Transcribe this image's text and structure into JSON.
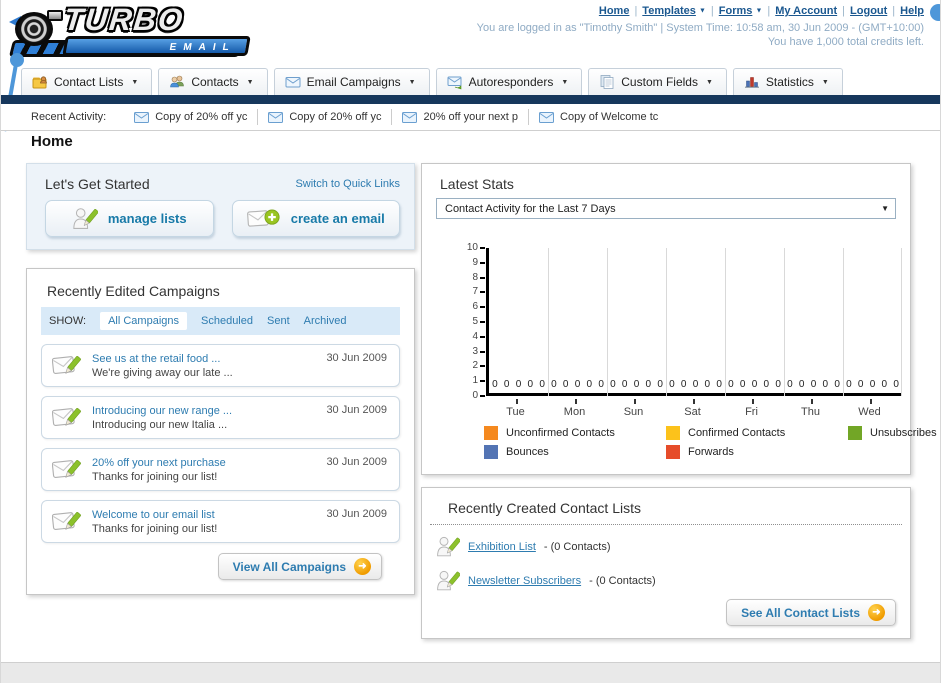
{
  "header": {
    "logo_title": "TURBO",
    "logo_subtitle": "EMAIL",
    "nav_links": [
      {
        "label": "Home",
        "dropdown": false
      },
      {
        "label": "Templates",
        "dropdown": true
      },
      {
        "label": "Forms",
        "dropdown": true
      },
      {
        "label": "My Account",
        "dropdown": false
      },
      {
        "label": "Logout",
        "dropdown": false
      },
      {
        "label": "Help",
        "dropdown": false
      }
    ],
    "login_info": "You are logged in as \"Timothy Smith\" | System Time: 10:58 am, 30 Jun 2009 - (GMT+10:00)",
    "credits_info": "You have 1,000 total credits left."
  },
  "nav_tabs": [
    {
      "label": "Contact Lists"
    },
    {
      "label": "Contacts"
    },
    {
      "label": "Email Campaigns"
    },
    {
      "label": "Autoresponders"
    },
    {
      "label": "Custom Fields"
    },
    {
      "label": "Statistics"
    }
  ],
  "recent_activity": {
    "label": "Recent Activity:",
    "items": [
      "Copy of 20% off yc",
      "Copy of 20% off yc",
      "20% off your next p",
      "Copy of Welcome tc"
    ]
  },
  "page_title": "Home",
  "get_started": {
    "title": "Let's Get Started",
    "switch_link": "Switch to Quick Links",
    "manage_lists_label": "manage lists",
    "create_email_label": "create an email"
  },
  "campaigns": {
    "title": "Recently Edited Campaigns",
    "show_label": "SHOW:",
    "filters": [
      "All Campaigns",
      "Scheduled",
      "Sent",
      "Archived"
    ],
    "active_filter": "All Campaigns",
    "items": [
      {
        "title": "See us at the retail food ...",
        "subtitle": "We're giving away our late ...",
        "date": "30 Jun 2009"
      },
      {
        "title": "Introducing our new range ...",
        "subtitle": "Introducing our new Italia ...",
        "date": "30 Jun 2009"
      },
      {
        "title": "20% off your next purchase",
        "subtitle": "Thanks for joining our list!",
        "date": "30 Jun 2009"
      },
      {
        "title": "Welcome to our email list",
        "subtitle": "Thanks for joining our list!",
        "date": "30 Jun 2009"
      }
    ],
    "view_all_label": "View All Campaigns"
  },
  "latest_stats": {
    "title": "Latest Stats",
    "dropdown_value": "Contact Activity for the Last 7 Days"
  },
  "chart_data": {
    "type": "bar",
    "title": "Contact Activity for the Last 7 Days",
    "categories": [
      "Tue",
      "Mon",
      "Sun",
      "Sat",
      "Fri",
      "Thu",
      "Wed"
    ],
    "series": [
      {
        "name": "Unconfirmed Contacts",
        "color": "#f5891f",
        "values": [
          0,
          0,
          0,
          0,
          0,
          0,
          0
        ]
      },
      {
        "name": "Confirmed Contacts",
        "color": "#fcc21b",
        "values": [
          0,
          0,
          0,
          0,
          0,
          0,
          0
        ]
      },
      {
        "name": "Unsubscribes",
        "color": "#72a626",
        "values": [
          0,
          0,
          0,
          0,
          0,
          0,
          0
        ]
      },
      {
        "name": "Bounces",
        "color": "#5374b4",
        "values": [
          0,
          0,
          0,
          0,
          0,
          0,
          0
        ]
      },
      {
        "name": "Forwards",
        "color": "#e64c2a",
        "values": [
          0,
          0,
          0,
          0,
          0,
          0,
          0
        ]
      }
    ],
    "xlabel": "",
    "ylabel": "",
    "ylim": [
      0,
      10
    ],
    "yticks": [
      0,
      1,
      2,
      3,
      4,
      5,
      6,
      7,
      8,
      9,
      10
    ],
    "grid": true,
    "legend_position": "bottom"
  },
  "contact_lists": {
    "title": "Recently Created Contact Lists",
    "items": [
      {
        "name": "Exhibition List",
        "detail": "- (0 Contacts)"
      },
      {
        "name": "Newsletter Subscribers",
        "detail": "- (0 Contacts)"
      }
    ],
    "see_all_label": "See All Contact Lists"
  },
  "colors": {
    "navy_bar": "#16375c",
    "link_blue": "#2e7cb0",
    "top_link_blue": "#1a578f",
    "button_text_teal": "#187aa8",
    "panel_blue_bg": "#edf3f9",
    "show_bar_bg": "#d9eaf8",
    "orange_button": "#f09c00",
    "pin_blue": "#4e97d9"
  }
}
